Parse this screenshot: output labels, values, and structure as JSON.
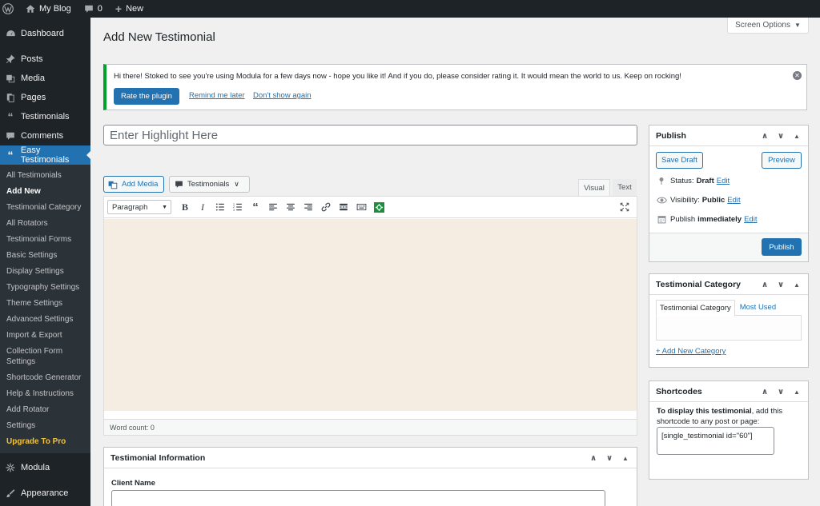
{
  "adminbar": {
    "site_name": "My Blog",
    "comments_count": "0",
    "new_label": "New"
  },
  "sidebar": {
    "items": [
      {
        "label": "Dashboard",
        "icon": "dashboard-icon"
      },
      {
        "label": "Posts",
        "icon": "pin-icon"
      },
      {
        "label": "Media",
        "icon": "media-icon"
      },
      {
        "label": "Pages",
        "icon": "pages-icon"
      },
      {
        "label": "Testimonials",
        "icon": "quote-icon"
      },
      {
        "label": "Comments",
        "icon": "comment-icon"
      },
      {
        "label": "Easy Testimonials",
        "icon": "quote-icon"
      }
    ],
    "submenu": [
      "All Testimonials",
      "Add New",
      "Testimonial Category",
      "All Rotators",
      "Testimonial Forms",
      "Basic Settings",
      "Display Settings",
      "Typography Settings",
      "Theme Settings",
      "Advanced Settings",
      "Import & Export",
      "Collection Form Settings",
      "Shortcode Generator",
      "Help & Instructions",
      "Add Rotator",
      "Settings",
      "Upgrade To Pro"
    ],
    "after": [
      {
        "label": "Modula",
        "icon": "gear-icon"
      },
      {
        "label": "Appearance",
        "icon": "brush-icon"
      }
    ]
  },
  "page": {
    "title": "Add New Testimonial",
    "screen_options": "Screen Options"
  },
  "notice": {
    "message": "Hi there! Stoked to see you're using Modula for a few days now - hope you like it! And if you do, please consider rating it. It would mean the world to us. Keep on rocking!",
    "rate_button": "Rate the plugin",
    "remind_link": "Remind me later",
    "dont_show_link": "Don't show again"
  },
  "editor": {
    "title_placeholder": "Enter Highlight Here",
    "add_media": "Add Media",
    "testimonials_dropdown": "Testimonials",
    "tab_visual": "Visual",
    "tab_text": "Text",
    "format": "Paragraph",
    "word_count": "Word count: 0"
  },
  "testimonial_info": {
    "title": "Testimonial Information",
    "client_name_label": "Client Name",
    "client_name_value": ""
  },
  "publish": {
    "title": "Publish",
    "save_draft": "Save Draft",
    "preview": "Preview",
    "status_label": "Status:",
    "status_value": "Draft",
    "visibility_label": "Visibility:",
    "visibility_value": "Public",
    "publish_label": "Publish",
    "publish_value": "immediately",
    "edit_link": "Edit",
    "publish_button": "Publish"
  },
  "category": {
    "title": "Testimonial Category",
    "tab_all": "Testimonial Category",
    "tab_most_used": "Most Used",
    "add_new": "+ Add New Category"
  },
  "shortcodes": {
    "title": "Shortcodes",
    "text_bold": "To display this testimonial",
    "text_rest": ", add this shortcode to any post or page:",
    "code": "[single_testimonial id=\"60\"]"
  },
  "colors": {
    "accent": "#2271b1",
    "admin_bar": "#1d2327",
    "notice_border": "#00a32a",
    "upgrade": "#f0c33c",
    "editor_bg": "#f5ede2"
  }
}
